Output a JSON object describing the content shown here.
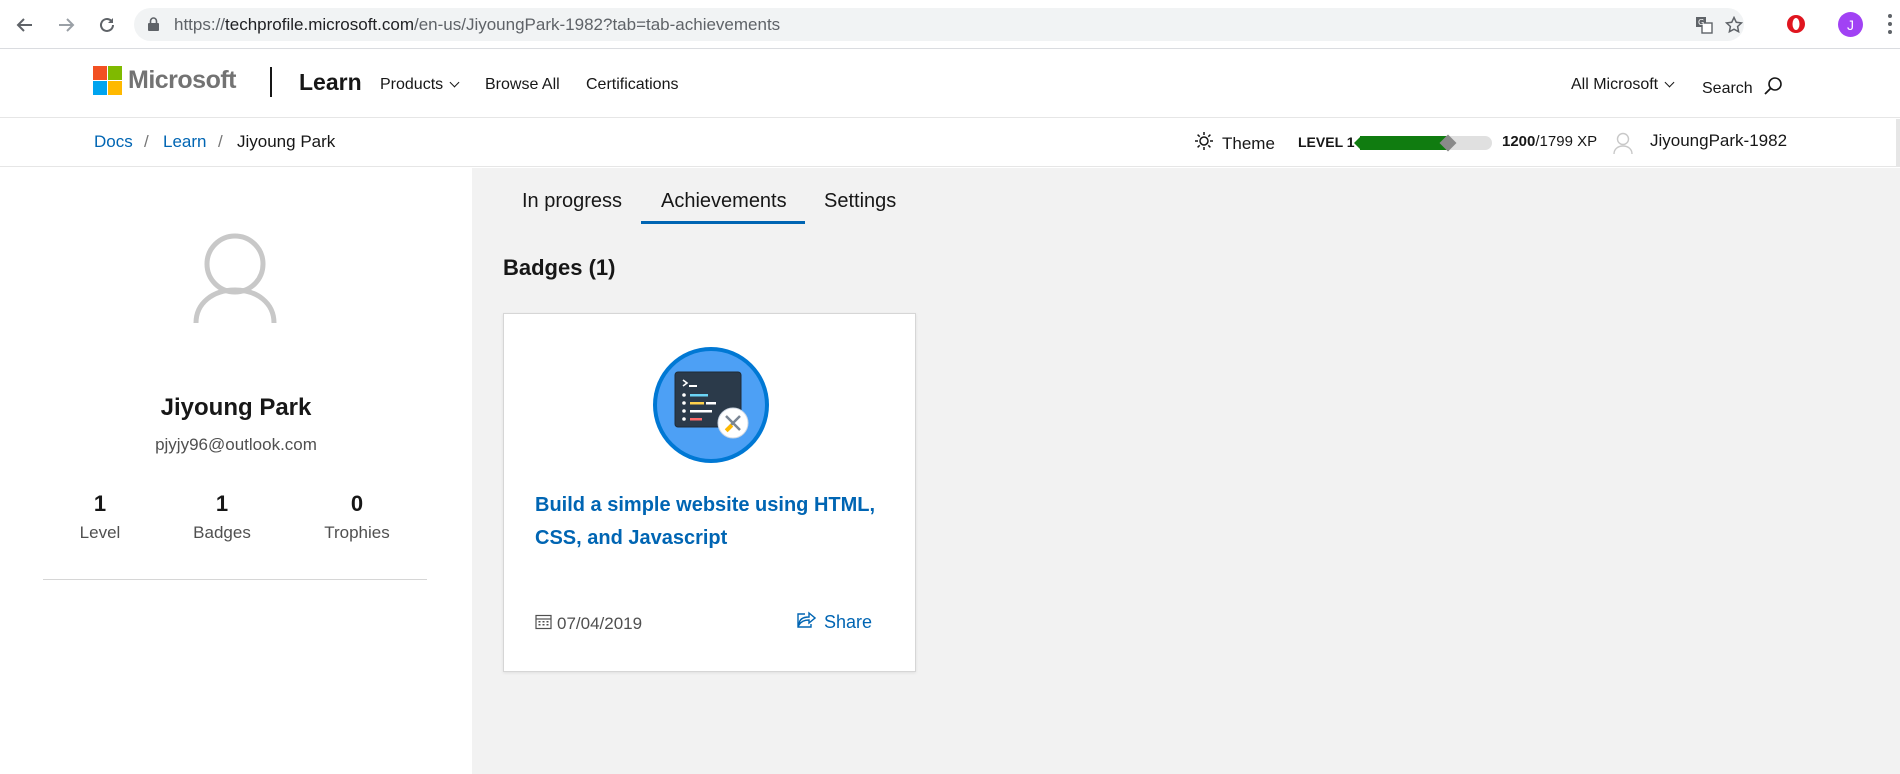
{
  "browser": {
    "url_prefix": "https://",
    "url_host": "techprofile.microsoft.com",
    "url_path": "/en-us/JiyoungPark-1982?tab=tab-achievements",
    "profile_initial": "J"
  },
  "header": {
    "brand": "Microsoft",
    "product": "Learn",
    "nav": {
      "products": "Products",
      "browse_all": "Browse All",
      "certifications": "Certifications",
      "all_microsoft": "All Microsoft",
      "search": "Search"
    }
  },
  "breadcrumb": {
    "items": [
      "Docs",
      "Learn",
      "Jiyoung Park"
    ],
    "separator": "/"
  },
  "user_bar": {
    "theme_label": "Theme",
    "level_label": "LEVEL 1",
    "xp_current": "1200",
    "xp_total": "/1799 XP",
    "xp_progress_fraction": 0.667,
    "username": "JiyoungPark-1982"
  },
  "profile": {
    "name": "Jiyoung Park",
    "email": "pjyjy96@outlook.com",
    "stats": [
      {
        "value": "1",
        "label": "Level"
      },
      {
        "value": "1",
        "label": "Badges"
      },
      {
        "value": "0",
        "label": "Trophies"
      }
    ]
  },
  "tabs": {
    "in_progress": "In progress",
    "achievements": "Achievements",
    "settings": "Settings",
    "active": "Achievements"
  },
  "badges_section": {
    "title": "Badges (1)",
    "items": [
      {
        "title": "Build a simple website using HTML, CSS, and Javascript",
        "date": "07/04/2019",
        "share_label": "Share"
      }
    ]
  },
  "colors": {
    "link": "#0065b3",
    "xp_fill": "#107c10",
    "main_bg": "#f2f2f2",
    "badge_ring": "#0078d4"
  }
}
